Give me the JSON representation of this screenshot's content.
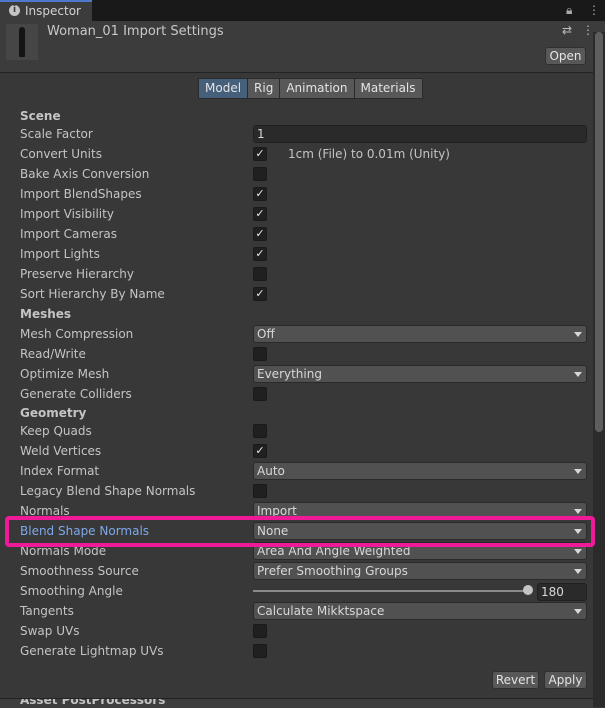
{
  "tab": {
    "label": "Inspector",
    "icon": "info-icon"
  },
  "header": {
    "title": "Woman_01 Import Settings",
    "open_label": "Open"
  },
  "toolbar": {
    "tabs": [
      "Model",
      "Rig",
      "Animation",
      "Materials"
    ],
    "active": "Model"
  },
  "scene": {
    "heading": "Scene",
    "scale_factor": {
      "label": "Scale Factor",
      "value": "1"
    },
    "convert_units": {
      "label": "Convert Units",
      "checked": true,
      "note": "1cm (File) to 0.01m (Unity)"
    },
    "bake_axis": {
      "label": "Bake Axis Conversion",
      "checked": false
    },
    "import_blendshapes": {
      "label": "Import BlendShapes",
      "checked": true
    },
    "import_visibility": {
      "label": "Import Visibility",
      "checked": true
    },
    "import_cameras": {
      "label": "Import Cameras",
      "checked": true
    },
    "import_lights": {
      "label": "Import Lights",
      "checked": true
    },
    "preserve_hierarchy": {
      "label": "Preserve Hierarchy",
      "checked": false
    },
    "sort_hierarchy": {
      "label": "Sort Hierarchy By Name",
      "checked": true
    }
  },
  "meshes": {
    "heading": "Meshes",
    "mesh_compression": {
      "label": "Mesh Compression",
      "value": "Off"
    },
    "read_write": {
      "label": "Read/Write",
      "checked": false
    },
    "optimize_mesh": {
      "label": "Optimize Mesh",
      "value": "Everything"
    },
    "generate_colliders": {
      "label": "Generate Colliders",
      "checked": false
    }
  },
  "geometry": {
    "heading": "Geometry",
    "keep_quads": {
      "label": "Keep Quads",
      "checked": false
    },
    "weld_vertices": {
      "label": "Weld Vertices",
      "checked": true
    },
    "index_format": {
      "label": "Index Format",
      "value": "Auto"
    },
    "legacy_blend": {
      "label": "Legacy Blend Shape Normals",
      "checked": false
    },
    "normals": {
      "label": "Normals",
      "value": "Import"
    },
    "blend_shape_normals": {
      "label": "Blend Shape Normals",
      "value": "None"
    },
    "normals_mode": {
      "label": "Normals Mode",
      "value": "Area And Angle Weighted"
    },
    "smoothness_source": {
      "label": "Smoothness Source",
      "value": "Prefer Smoothing Groups"
    },
    "smoothing_angle": {
      "label": "Smoothing Angle",
      "value": "180",
      "fraction": 1.0
    },
    "tangents": {
      "label": "Tangents",
      "value": "Calculate Mikktspace"
    },
    "swap_uvs": {
      "label": "Swap UVs",
      "checked": false
    },
    "generate_lightmap": {
      "label": "Generate Lightmap UVs",
      "checked": false
    }
  },
  "footer": {
    "revert_label": "Revert",
    "apply_label": "Apply"
  },
  "next_section": {
    "label": "Asset PostProcessors"
  },
  "colors": {
    "highlight": "#ee1a9a",
    "active_tab": "#46607c",
    "link_label": "#7fa8e8"
  }
}
